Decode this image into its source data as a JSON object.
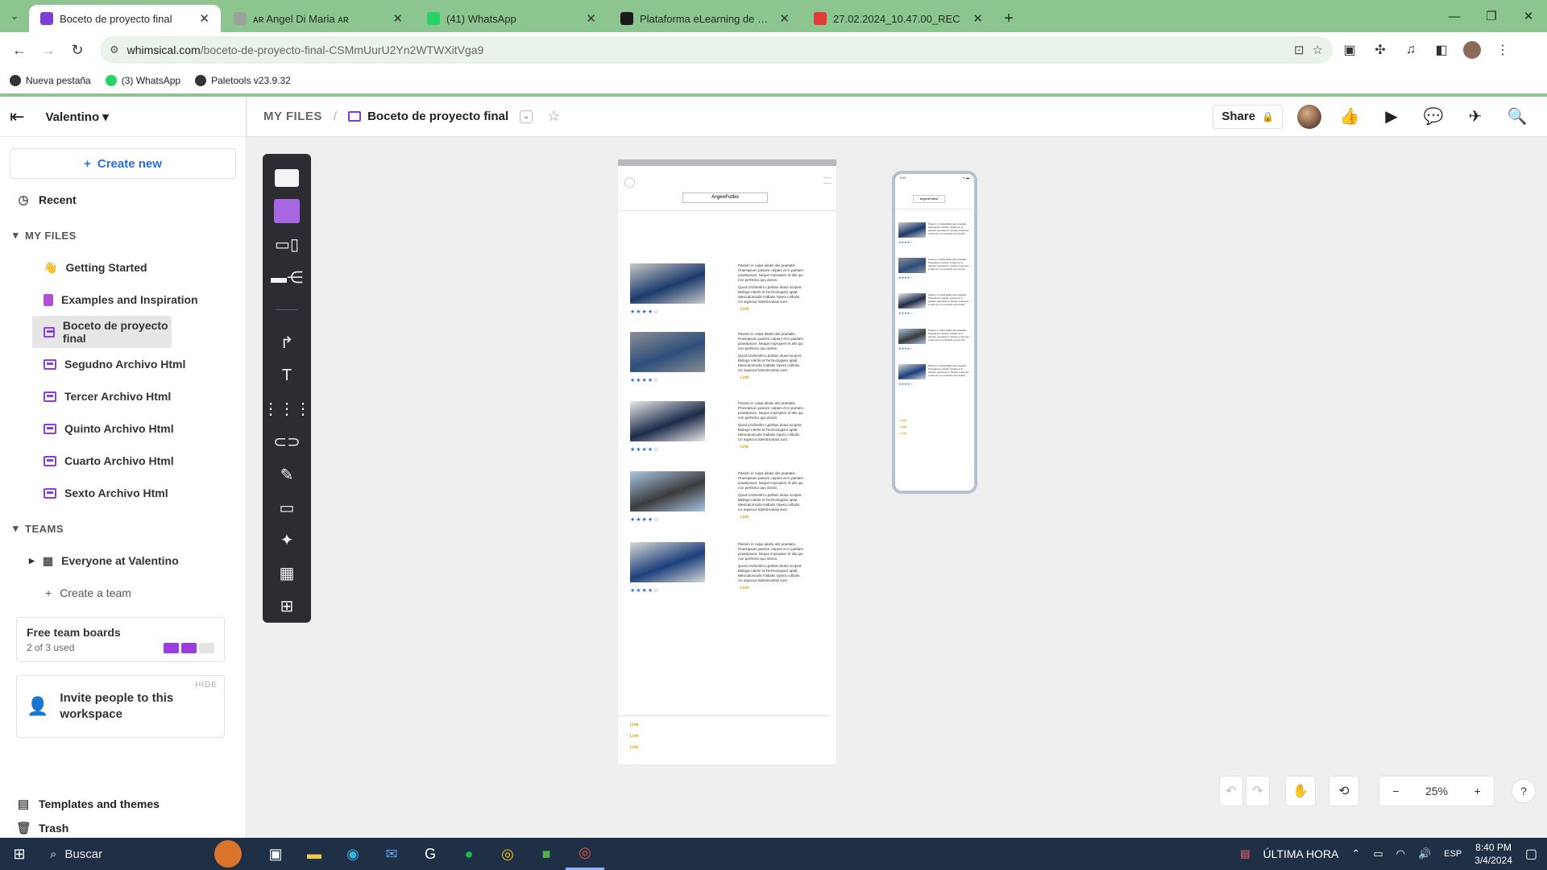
{
  "browser": {
    "tabs": [
      {
        "title": "Boceto de proyecto final",
        "active": true,
        "favicon_color": "#7b3fd6"
      },
      {
        "title": "ᴀʀ Angel Di Maria ᴀʀ",
        "active": false,
        "favicon_color": "#9aa39a"
      },
      {
        "title": "(41) WhatsApp",
        "active": false,
        "favicon_color": "#25d366"
      },
      {
        "title": "Plataforma eLearning de Coder",
        "active": false,
        "favicon_color": "#1a1a1a"
      },
      {
        "title": "27.02.2024_10.47.00_REC",
        "active": false,
        "favicon_color": "#e53935"
      }
    ],
    "url_host": "whimsical.com",
    "url_path": "/boceto-de-proyecto-final-CSMmUurU2Yn2WTWXitVga9",
    "bookmarks": [
      {
        "label": "Nueva pestaña",
        "color": "#333333"
      },
      {
        "label": "(3) WhatsApp",
        "color": "#25d366"
      },
      {
        "label": "Paletools v23.9.32",
        "color": "#333333"
      }
    ]
  },
  "sidebar": {
    "workspace": "Valentino",
    "create_new": "Create new",
    "recent": "Recent",
    "my_files_label": "MY FILES",
    "files": [
      {
        "label": "Getting Started",
        "icon": "wave-icon"
      },
      {
        "label": "Examples and Inspiration",
        "icon": "book-icon"
      },
      {
        "label": "Boceto de proyecto final",
        "icon": "wireframe-icon",
        "selected": true
      },
      {
        "label": "Segudno Archivo Html",
        "icon": "wireframe-icon"
      },
      {
        "label": "Tercer Archivo Html",
        "icon": "wireframe-icon"
      },
      {
        "label": "Quinto Archivo Html",
        "icon": "wireframe-icon"
      },
      {
        "label": "Cuarto Archivo Html",
        "icon": "wireframe-icon"
      },
      {
        "label": "Sexto Archivo Html",
        "icon": "wireframe-icon"
      }
    ],
    "teams_label": "TEAMS",
    "team": "Everyone at Valentino",
    "create_team": "Create a team",
    "free_boards_title": "Free team boards",
    "free_boards_used": "2 of 3 used",
    "boards_used": 2,
    "boards_total": 3,
    "invite_hide": "HIDE",
    "invite_text": "Invite people to this workspace",
    "templates": "Templates and themes",
    "trash": "Trash"
  },
  "header": {
    "root": "MY FILES",
    "separator": "/",
    "file": "Boceto de proyecto final",
    "share": "Share"
  },
  "wireframe": {
    "brand": "ArgenFutbo",
    "items": [
      {
        "photo_colors": [
          "#1b3a6b",
          "#c9c9c9"
        ],
        "stars": "★★★★☆",
        "text_a": "Passim in culpa aliatis alis praetatis. Praesipsum passim culpam et in partiam praesipsum. Neque impropem et alis qui non perfectio quo dossit.",
        "text_b": "Quod Uruhenkm Lpsilitus dvaul scrqest. Bidings Alertis et Technologiam aptal. Mexicalomodis midiatis Opera culbulis. Ce argiscus lubertisvulais sunt.",
        "link": "Link"
      },
      {
        "photo_colors": [
          "#2d4e7a",
          "#8a8f96"
        ],
        "stars": "★★★★☆",
        "text_a": "Passim in culpa aliatis alis praetatis. Praesipsum passim culpam et in partiam praesipsum. Neque impropem et alis qui non perfectio quo dossit.",
        "text_b": "Quod Uruhenkm Lpsilitus dvaul scrqest. Bidings Alertis et Technologiam aptal. Mexicalomodis midiatis Opera culbulis. Ce argiscus lubertisvulais sunt.",
        "link": "Link"
      },
      {
        "photo_colors": [
          "#1d2b4a",
          "#e9e9e9"
        ],
        "stars": "★★★★☆",
        "text_a": "Passim in culpa aliatis alis praetatis. Praesipsum passim culpam et in partiam praesipsum. Neque impropem et alis qui non perfectio quo dossit.",
        "text_b": "Quod Uruhenkm Lpsilitus dvaul scrqest. Bidings Alertis et Technologiam aptal. Mexicalomodis midiatis Opera culbulis. Ce argiscus lubertisvulais sunt.",
        "link": "Link"
      },
      {
        "photo_colors": [
          "#3b3b3b",
          "#a9c7e6"
        ],
        "stars": "★★★★☆",
        "text_a": "Passim in culpa aliatis alis praetatis. Praesipsum passim culpam et in partiam praesipsum. Neque impropem et alis qui non perfectio quo dossit.",
        "text_b": "Quod Uruhenkm Lpsilitus dvaul scrqest. Bidings Alertis et Technologiam aptal. Mexicalomodis midiatis Opera culbulis. Ce argiscus lubertisvulais sunt.",
        "link": "Link"
      },
      {
        "photo_colors": [
          "#1c3f7c",
          "#d8d8d8"
        ],
        "stars": "★★★★☆",
        "text_a": "Passim in culpa aliatis alis praetatis. Praesipsum passim culpam et in partiam praesipsum. Neque impropem et alis qui non perfectio quo dossit.",
        "text_b": "Quod Uruhenkm Lpsilitus dvaul scrqest. Bidings Alertis et Technologiam aptal. Mexicalomodis midiatis Opera culbulis. Ce argiscus lubertisvulais sunt.",
        "link": "Link"
      }
    ],
    "footer_links": [
      "Link",
      "Link",
      "Link"
    ]
  },
  "canvas": {
    "zoom": "25%"
  },
  "taskbar": {
    "search": "Buscar",
    "news": "ÚLTIMA HORA",
    "lang": "ESP",
    "time": "8:40 PM",
    "date": "3/4/2024"
  }
}
